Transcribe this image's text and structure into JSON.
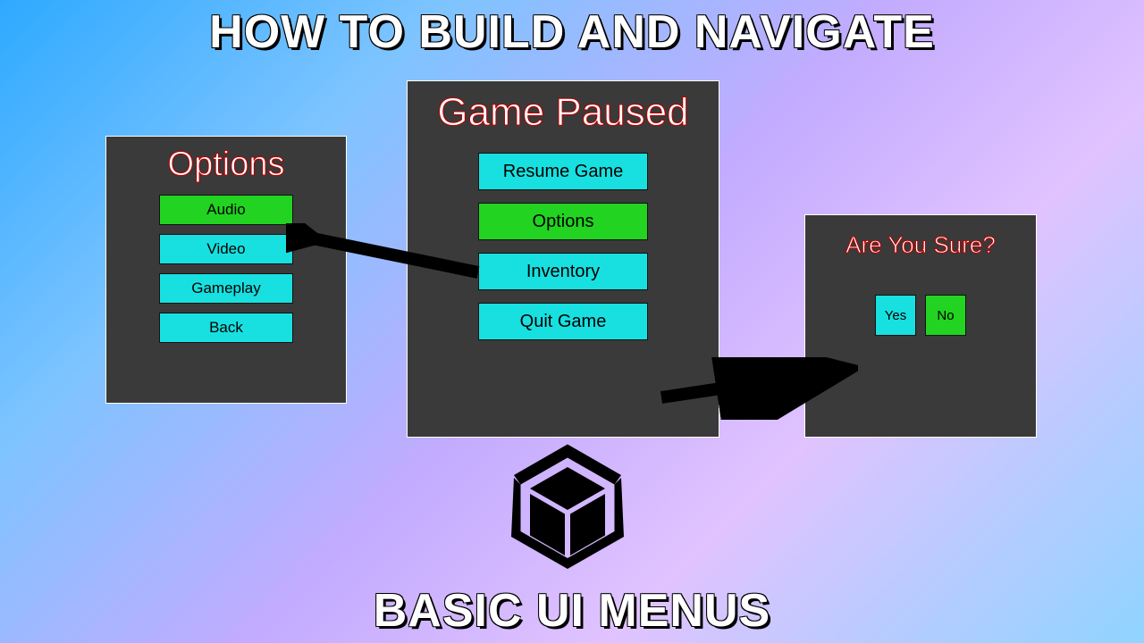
{
  "titles": {
    "top": "HOW TO BUILD AND NAVIGATE",
    "bottom": "BASIC UI MENUS"
  },
  "panels": {
    "options": {
      "title": "Options",
      "buttons": [
        "Audio",
        "Video",
        "Gameplay",
        "Back"
      ],
      "highlight_index": 0
    },
    "pause": {
      "title": "Game Paused",
      "buttons": [
        "Resume Game",
        "Options",
        "Inventory",
        "Quit Game"
      ],
      "highlight_index": 1
    },
    "confirm": {
      "title": "Are You Sure?",
      "yes": "Yes",
      "no": "No",
      "highlight": "no"
    }
  },
  "colors": {
    "cyan": "#18e0e0",
    "green": "#22d321",
    "panel": "#3a3a3a"
  },
  "icon": "unity-icon"
}
